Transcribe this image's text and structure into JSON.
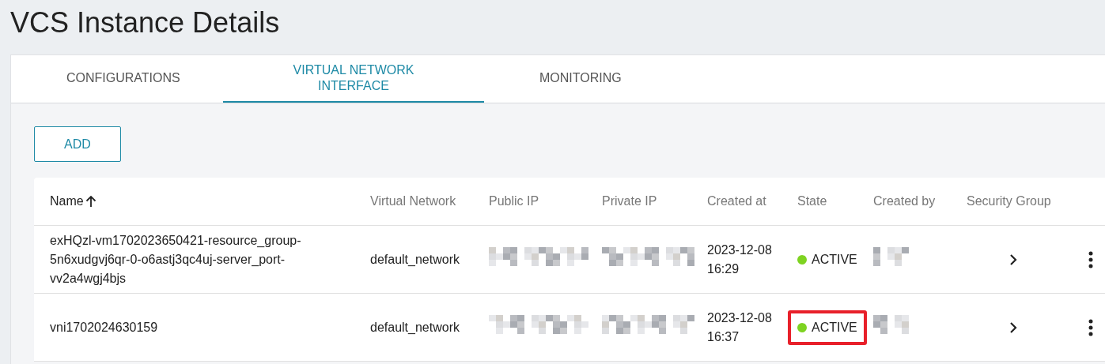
{
  "page_title": "VCS Instance Details",
  "tabs": [
    {
      "label": "CONFIGURATIONS",
      "selected": false
    },
    {
      "label": "VIRTUAL NETWORK INTERFACE",
      "selected": true
    },
    {
      "label": "MONITORING",
      "selected": false
    }
  ],
  "add_button": "ADD",
  "table": {
    "columns": [
      {
        "label": "Name",
        "sorted": true
      },
      {
        "label": "Virtual Network",
        "sorted": false
      },
      {
        "label": "Public IP",
        "sorted": false
      },
      {
        "label": "Private IP",
        "sorted": false
      },
      {
        "label": "Created at",
        "sorted": false
      },
      {
        "label": "State",
        "sorted": false
      },
      {
        "label": "Created by",
        "sorted": false
      },
      {
        "label": "Security Group",
        "sorted": false
      }
    ],
    "rows": [
      {
        "name": "exHQzl-vm1702023650421-resource_group-5n6xudgvj6qr-0-o6astj3qc4uj-server_port-vv2a4wgj4bjs",
        "virtual_network": "default_network",
        "public_ip_redacted": true,
        "private_ip_redacted": true,
        "created_at": [
          "2023-12-08",
          "16:29"
        ],
        "state": "ACTIVE",
        "color": "#7ed321",
        "created_by_redacted": true,
        "highlighted": false
      },
      {
        "name": "vni1702024630159",
        "virtual_network": "default_network",
        "public_ip_redacted": true,
        "private_ip_redacted": true,
        "created_at": [
          "2023-12-08",
          "16:37"
        ],
        "state": "ACTIVE",
        "color": "#7ed321",
        "created_by_redacted": true,
        "highlighted": true
      }
    ]
  }
}
